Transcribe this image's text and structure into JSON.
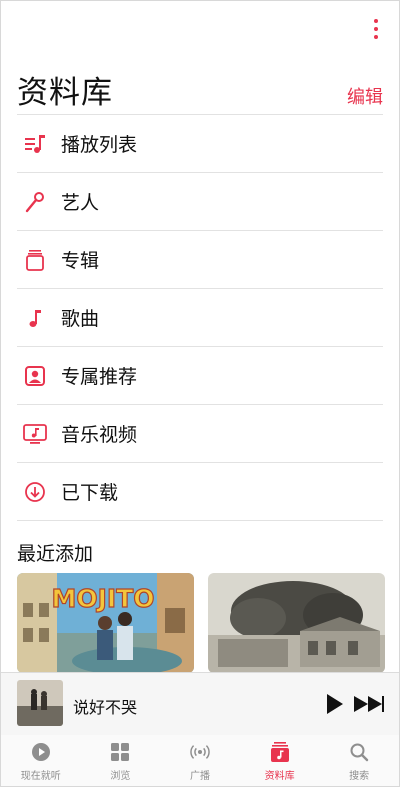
{
  "header": {
    "title": "资料库",
    "edit_label": "编辑"
  },
  "menu_items": [
    {
      "label": "播放列表",
      "icon": "playlist-icon"
    },
    {
      "label": "艺人",
      "icon": "microphone-icon"
    },
    {
      "label": "专辑",
      "icon": "album-stack-icon"
    },
    {
      "label": "歌曲",
      "icon": "music-note-icon"
    },
    {
      "label": "专属推荐",
      "icon": "person-square-icon"
    },
    {
      "label": "音乐视频",
      "icon": "music-video-icon"
    },
    {
      "label": "已下载",
      "icon": "download-circle-icon"
    }
  ],
  "recent": {
    "title": "最近添加",
    "albums": [
      {
        "cover_text": "MOJITO"
      },
      {
        "cover_text": ""
      }
    ]
  },
  "now_playing": {
    "title": "说好不哭"
  },
  "tabs": [
    {
      "label": "现在就听",
      "icon": "listen-now-icon"
    },
    {
      "label": "浏览",
      "icon": "browse-grid-icon"
    },
    {
      "label": "广播",
      "icon": "radio-icon"
    },
    {
      "label": "资料库",
      "icon": "library-icon",
      "active": true
    },
    {
      "label": "搜索",
      "icon": "search-icon"
    }
  ],
  "colors": {
    "accent": "#e8344e",
    "inactive": "#8e8e8e"
  }
}
